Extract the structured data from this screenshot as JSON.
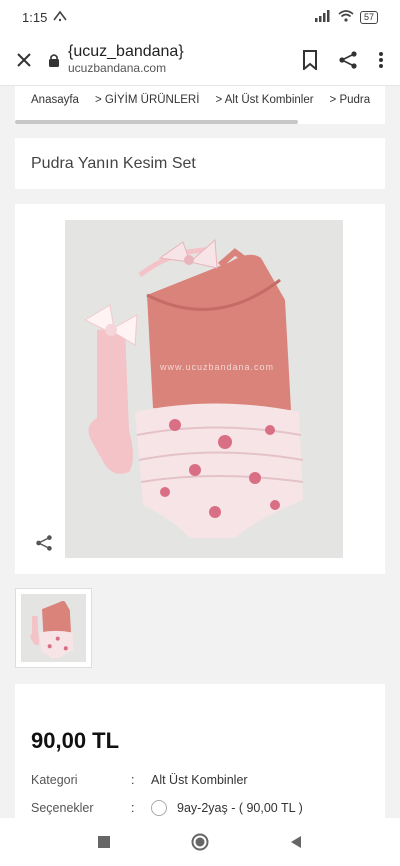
{
  "status": {
    "time": "1:15",
    "battery": "57"
  },
  "browser": {
    "title": "{ucuz_bandana}",
    "domain": "ucuzbandana.com"
  },
  "breadcrumb": [
    {
      "label": "Anasayfa"
    },
    {
      "label": "> GİYİM ÜRÜNLERİ"
    },
    {
      "label": "> Alt Üst Kombinler"
    },
    {
      "label": "> Pudra"
    }
  ],
  "product": {
    "name": "Pudra Yanın Kesim Set",
    "watermark": "www.ucuzbandana.com",
    "price": "90,00 TL",
    "category_label": "Kategori",
    "category_value": "Alt Üst Kombinler",
    "options_label": "Seçenekler",
    "option_value": "9ay-2yaş - ( 90,00 TL )",
    "colon": ":"
  },
  "colors": {
    "top": "#d9837b",
    "sock": "#f3c3c8",
    "bloomer": "#f6e4e6",
    "flower": "#d96f84",
    "background": "#e4e4e2"
  }
}
